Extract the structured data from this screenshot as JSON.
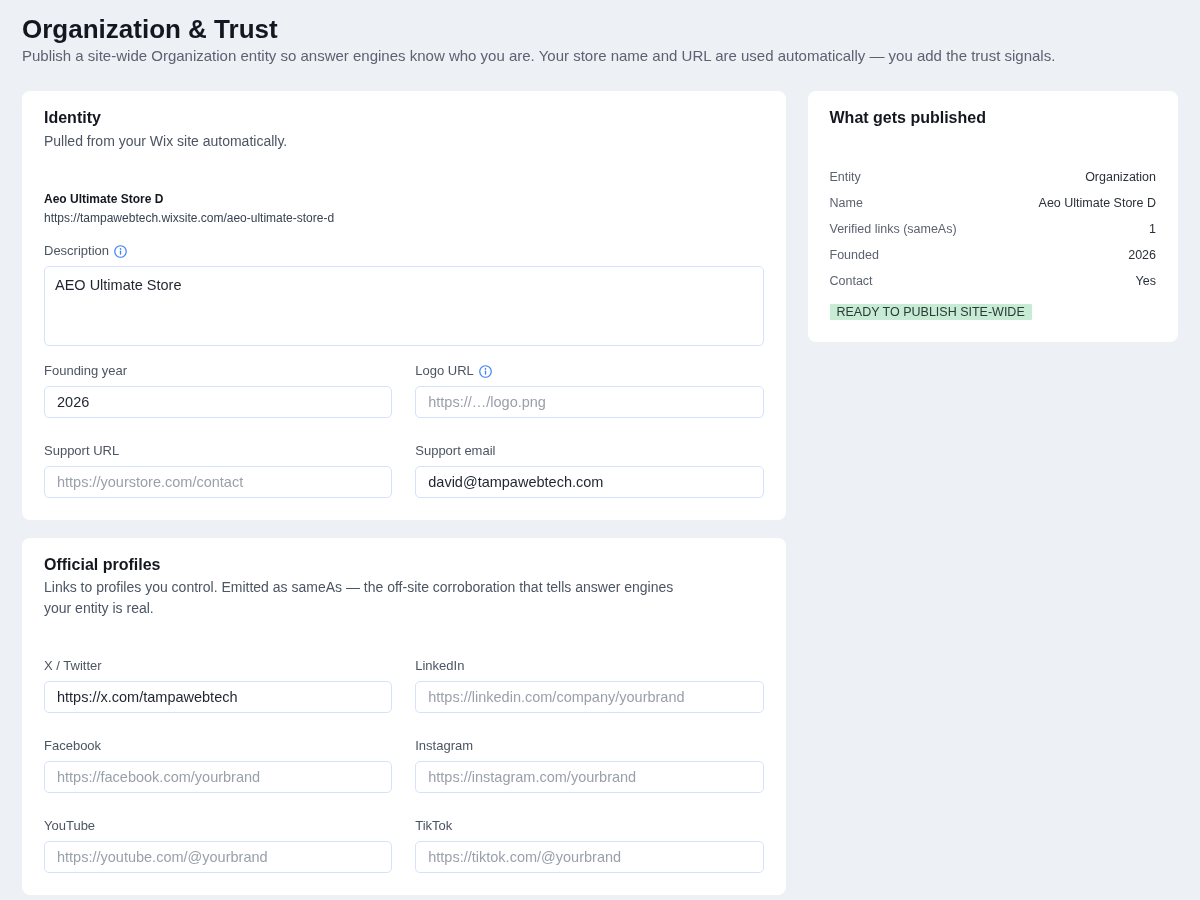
{
  "page": {
    "title": "Organization & Trust",
    "subtitle": "Publish a site-wide Organization entity so answer engines know who you are. Your store name and URL are used automatically — you add the trust signals."
  },
  "identity": {
    "title": "Identity",
    "subtitle": "Pulled from your Wix site automatically.",
    "store_name": "Aeo Ultimate Store D",
    "store_url": "https://tampawebtech.wixsite.com/aeo-ultimate-store-d",
    "description": {
      "label": "Description",
      "info": true,
      "value": "AEO Ultimate Store"
    },
    "fields": [
      {
        "label": "Founding year",
        "info": false,
        "value": "2026"
      },
      {
        "label": "Logo URL",
        "info": true,
        "placeholder": "https://…/logo.png"
      },
      {
        "label": "Support URL",
        "info": false,
        "placeholder": "https://yourstore.com/contact"
      },
      {
        "label": "Support email",
        "info": false,
        "value": "david@tampawebtech.com"
      }
    ]
  },
  "profiles": {
    "title": "Official profiles",
    "subtitle": "Links to profiles you control. Emitted as sameAs — the off-site corroboration that tells answer engines your entity is real.",
    "fields": [
      {
        "label": "X / Twitter",
        "value": "https://x.com/tampawebtech"
      },
      {
        "label": "LinkedIn",
        "placeholder": "https://linkedin.com/company/yourbrand"
      },
      {
        "label": "Facebook",
        "placeholder": "https://facebook.com/yourbrand"
      },
      {
        "label": "Instagram",
        "placeholder": "https://instagram.com/yourbrand"
      },
      {
        "label": "YouTube",
        "placeholder": "https://youtube.com/@yourbrand"
      },
      {
        "label": "TikTok",
        "placeholder": "https://tiktok.com/@yourbrand"
      }
    ]
  },
  "summary": {
    "title": "What gets published",
    "rows": [
      {
        "label": "Entity",
        "value": "Organization"
      },
      {
        "label": "Name",
        "value": "Aeo Ultimate Store D"
      },
      {
        "label": "Verified links (sameAs)",
        "value": "1"
      },
      {
        "label": "Founded",
        "value": "2026"
      },
      {
        "label": "Contact",
        "value": "Yes"
      }
    ],
    "badge": "READY TO PUBLISH SITE-WIDE"
  }
}
